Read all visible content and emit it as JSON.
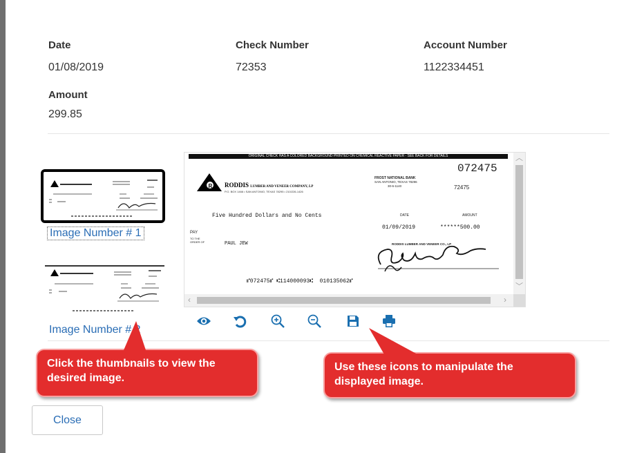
{
  "details": {
    "date_label": "Date",
    "date_value": "01/08/2019",
    "check_number_label": "Check Number",
    "check_number_value": "72353",
    "account_number_label": "Account Number",
    "account_number_value": "1122334451",
    "amount_label": "Amount",
    "amount_value": "299.85"
  },
  "thumbnails": [
    {
      "label": "Image Number # 1",
      "selected": true
    },
    {
      "label": "Image Number # 2",
      "selected": false
    }
  ],
  "check": {
    "banner": "ORIGINAL CHECK HAS A COLORED BACKGROUND PRINTED ON CHEMICAL REACTIVE PAPER - SEE BACK FOR DETAILS",
    "check_no": "072475",
    "bank_name": "FROST NATIONAL BANK",
    "bank_city": "SAN ANTONIO, TEXAS 78296",
    "bank_code": "30-6-1140",
    "ref": "72475",
    "company_name": "RODDIS",
    "company_suffix": "LUMBER AND VENEER COMPANY, LP",
    "company_address": "P.O. BOX 1466 • SAN ANTONIO, TEXAS 78295 • 210/226-1426",
    "amount_words": "Five Hundred Dollars and No Cents",
    "date_caption": "DATE",
    "amount_caption": "AMOUNT",
    "date": "01/09/2019",
    "amount": "******500.00",
    "pay_label": "PAY",
    "to_order_label": "TO THE ORDER OF",
    "payee": "PAUL JEW",
    "signer_company": "RODDIS LUMBER AND VENEER CO., LP",
    "micr": "⑈072475⑈ ⑆114000093⑆  010135062⑈"
  },
  "toolbar": {
    "icons": [
      "eye-icon",
      "rotate-icon",
      "zoom-in-icon",
      "zoom-out-icon",
      "save-icon",
      "print-icon"
    ],
    "accent": "#1a6fb0"
  },
  "callouts": {
    "thumbnails_hint": "Click the thumbnails to view the desired image.",
    "icons_hint": "Use these icons to manipulate the displayed image."
  },
  "close_label": "Close"
}
